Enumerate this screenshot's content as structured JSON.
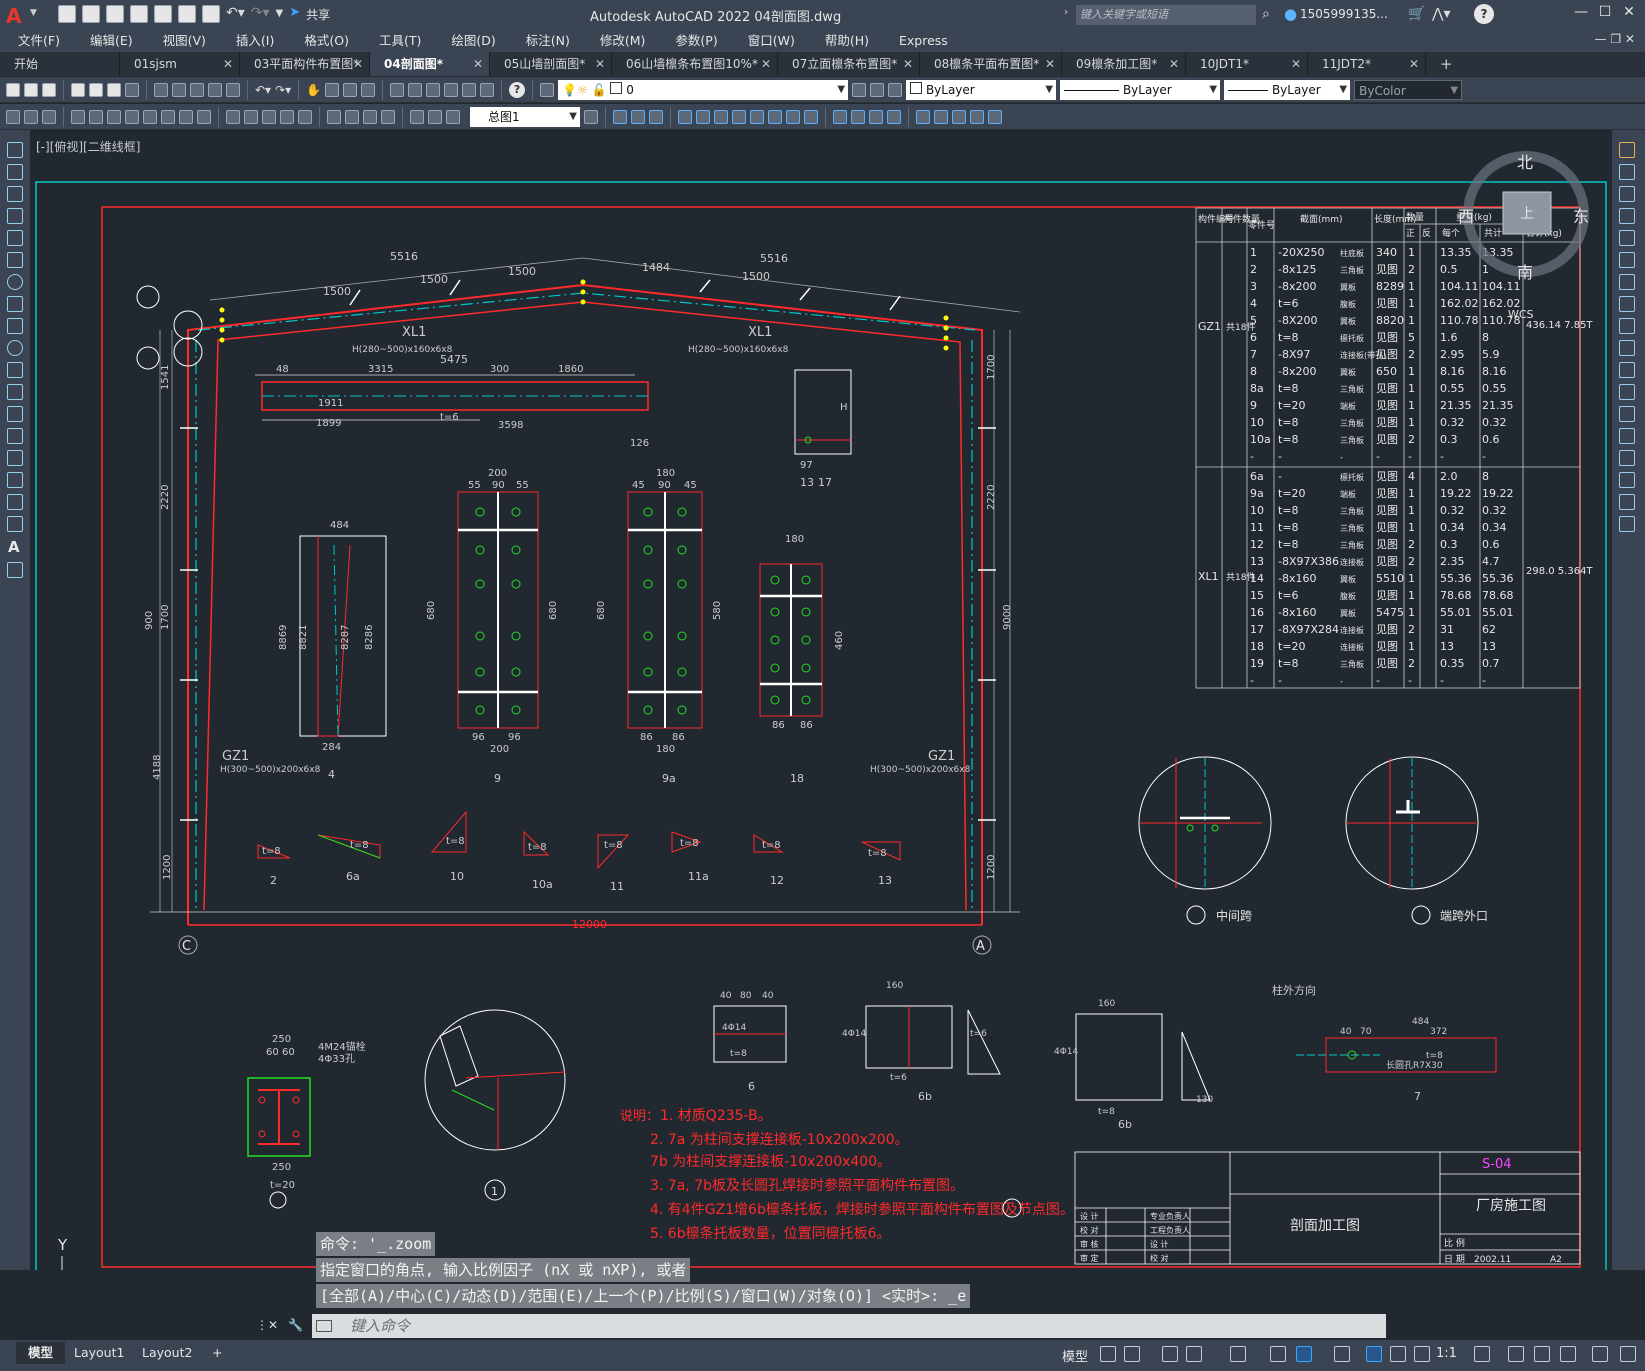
{
  "app": {
    "logo": "A",
    "title": "Autodesk AutoCAD 2022    04剖面图.dwg",
    "share": "共享",
    "search_placeholder": "键入关键字或短语",
    "user": "1505999135...",
    "help": "?"
  },
  "menu": [
    "文件(F)",
    "编辑(E)",
    "视图(V)",
    "插入(I)",
    "格式(O)",
    "工具(T)",
    "绘图(D)",
    "标注(N)",
    "修改(M)",
    "参数(P)",
    "窗口(W)",
    "帮助(H)",
    "Express"
  ],
  "tabs": [
    {
      "label": "开始",
      "active": false
    },
    {
      "label": "01sjsm",
      "active": false
    },
    {
      "label": "03平面构件布置图*",
      "active": false
    },
    {
      "label": "04剖面图*",
      "active": true
    },
    {
      "label": "05山墙剖面图*",
      "active": false
    },
    {
      "label": "06山墙檩条布置图10%*",
      "active": false
    },
    {
      "label": "07立面檩条布置图*",
      "active": false
    },
    {
      "label": "08檩条平面布置图*",
      "active": false
    },
    {
      "label": "09檩条加工图*",
      "active": false
    },
    {
      "label": "10JDT1*",
      "active": false
    },
    {
      "label": "11JDT2*",
      "active": false
    }
  ],
  "toolbar1": {
    "layer": "0",
    "color": "ByLayer",
    "linetype": "ByLayer",
    "lineweight": "ByLayer",
    "plotstyle": "ByColor"
  },
  "toolbar2": {
    "dimstyle": "总图1"
  },
  "viewport": {
    "label": "[-][俯视][二维线框]",
    "viewcube": {
      "north": "北",
      "south": "南",
      "east": "东",
      "west": "西",
      "top": "上",
      "wcs": "WCS"
    }
  },
  "drawing": {
    "frame_labels": [
      "GZ1",
      "XL1",
      "XL1",
      "GZ1"
    ],
    "beam_section": "H(280~500)x160x6x8",
    "column_section": "H(300~500)x200x6x8",
    "dims_top": [
      "1500",
      "1500",
      "1500",
      "1484",
      "1484",
      "1500",
      "1500",
      "1500",
      "5516",
      "5516",
      "5475"
    ],
    "span": "12000",
    "axis_c": "C",
    "axis_a": "A",
    "dims_left": [
      "1541",
      "2220",
      "900",
      "1700",
      "4188",
      "1200"
    ],
    "dims_right": [
      "1700",
      "2220",
      "9000",
      "1200"
    ],
    "detail_bar": [
      "48",
      "3315",
      "300",
      "1860",
      "1911",
      "1899",
      "3598",
      "t=6",
      "15",
      "132",
      "126"
    ],
    "plate_dims": [
      "200",
      "55",
      "90",
      "55",
      "180",
      "45",
      "90",
      "45",
      "484",
      "96",
      "86",
      "8",
      "680",
      "580",
      "460",
      "8869",
      "8821",
      "8287",
      "8286",
      "284",
      "97",
      "H"
    ],
    "small_parts": [
      "t=8",
      "t=8",
      "t=8",
      "t=8",
      "t=8",
      "t=8",
      "t=8",
      "t=8",
      "t=8"
    ],
    "callouts": [
      "2",
      "6a",
      "10",
      "10a",
      "11",
      "11a",
      "12",
      "13",
      "4",
      "9",
      "9a",
      "18",
      "13",
      "17",
      "1",
      "6",
      "6b",
      "6b",
      "7"
    ],
    "notes_title": "说明：",
    "notes": [
      "1. 材质Q235-B。",
      "2. 7a 为柱间支撑连接板-10x200x200。",
      "   7b 为柱间支撑连接板-10x200x400。",
      "3. 7a, 7b板及长圆孔焊接时参照平面构件布置图。",
      "4. 有4件GZ1增6b檩条托板，焊接时参照平面构件布置图及节点图。",
      "5. 6b檩条托板数量，位置同檩托板6。"
    ],
    "detail2_label": "中间跨",
    "detail3_label": "端跨外口",
    "base_plate": {
      "dims": [
        "250",
        "60",
        "60",
        "250",
        "4M24锚栓",
        "4Φ33孔",
        "t=20"
      ],
      "callout": "1"
    },
    "detail_plates": {
      "p6": [
        "40",
        "80",
        "40",
        "4Φ14",
        "50",
        "80",
        "50",
        "t=8"
      ],
      "p6b": [
        "160",
        "40",
        "80",
        "40",
        "4Φ14",
        "50",
        "80",
        "50",
        "150",
        "t=6",
        "80"
      ],
      "p6a": [
        "160",
        "40",
        "80",
        "40",
        "4Φ14",
        "50",
        "80",
        "257",
        "147",
        "t=8",
        "130",
        "t=6"
      ],
      "p7": [
        "柱外方向",
        "484",
        "40",
        "70",
        "372",
        "48",
        "49",
        "97",
        "长圆孔R7X30",
        "t=8"
      ]
    }
  },
  "table": {
    "headers": [
      "构件编号",
      "构件数量",
      "零件号",
      "截面(mm)",
      "长度(mm)",
      "数量",
      "正",
      "反",
      "重量(kg)",
      "每个",
      "共计",
      "合计(kg)"
    ],
    "groups": [
      {
        "member": "GZ1",
        "qty": "共18件",
        "total": "436.14 7.85T",
        "rows": [
          [
            "1",
            "-20X250",
            "柱底板",
            "340",
            "1",
            "13.35",
            "13.35"
          ],
          [
            "2",
            "-8x125",
            "三角板",
            "见图",
            "2",
            "0.5",
            "1"
          ],
          [
            "3",
            "-8x200",
            "翼板",
            "8289",
            "1",
            "104.11",
            "104.11"
          ],
          [
            "4",
            "t=6",
            "腹板",
            "见图",
            "1",
            "162.02",
            "162.02"
          ],
          [
            "5",
            "-8X200",
            "翼板",
            "8820",
            "1",
            "110.78",
            "110.78"
          ],
          [
            "6",
            "t=8",
            "檩托板",
            "见图",
            "5",
            "1.6",
            "8"
          ],
          [
            "7",
            "-8X97",
            "连接板(带孔)",
            "见图",
            "2",
            "2.95",
            "5.9"
          ],
          [
            "8",
            "-8x200",
            "翼板",
            "650",
            "1",
            "8.16",
            "8.16"
          ],
          [
            "8a",
            "t=8",
            "三角板",
            "见图",
            "1",
            "0.55",
            "0.55"
          ],
          [
            "9",
            "t=20",
            "端板",
            "见图",
            "1",
            "21.35",
            "21.35"
          ],
          [
            "10",
            "t=8",
            "三角板",
            "见图",
            "1",
            "0.32",
            "0.32"
          ],
          [
            "10a",
            "t=8",
            "三角板",
            "见图",
            "2",
            "0.3",
            "0.6"
          ],
          [
            "-",
            "-",
            "-",
            "-",
            "-",
            "-",
            "-"
          ]
        ]
      },
      {
        "member": "XL1",
        "qty": "共18件",
        "total": "298.0 5.364T",
        "rows": [
          [
            "6a",
            "-",
            "檩托板",
            "见图",
            "4",
            "2.0",
            "8"
          ],
          [
            "9a",
            "t=20",
            "端板",
            "见图",
            "1",
            "19.22",
            "19.22"
          ],
          [
            "10",
            "t=8",
            "三角板",
            "见图",
            "1",
            "0.32",
            "0.32"
          ],
          [
            "11",
            "t=8",
            "三角板",
            "见图",
            "1",
            "0.34",
            "0.34"
          ],
          [
            "12",
            "t=8",
            "三角板",
            "见图",
            "2",
            "0.3",
            "0.6"
          ],
          [
            "13",
            "-8X97X386",
            "连接板",
            "见图",
            "2",
            "2.35",
            "4.7"
          ],
          [
            "14",
            "-8x160",
            "翼板",
            "5510",
            "1",
            "55.36",
            "55.36"
          ],
          [
            "15",
            "t=6",
            "腹板",
            "见图",
            "1",
            "78.68",
            "78.68"
          ],
          [
            "16",
            "-8x160",
            "翼板",
            "5475",
            "1",
            "55.01",
            "55.01"
          ],
          [
            "17",
            "-8X97X284",
            "连接板",
            "见图",
            "2",
            "31",
            "62"
          ],
          [
            "18",
            "t=20",
            "连接板",
            "见图",
            "1",
            "13",
            "13"
          ],
          [
            "19",
            "t=8",
            "三角板",
            "见图",
            "2",
            "0.35",
            "0.7"
          ],
          [
            "-",
            "-",
            "-",
            "-",
            "-",
            "-",
            "-"
          ]
        ]
      }
    ]
  },
  "titleblock": {
    "drawing_no": "S-04",
    "project": "厂房施工图",
    "drawing_name": "剖面加工图",
    "row_labels": [
      "比 例",
      "日 期"
    ],
    "date": "2002.11",
    "sheet": "A2",
    "roles": [
      "设 计",
      "校 对",
      "审 核",
      "审 定",
      "制 图"
    ],
    "role_col": [
      "专业负责人",
      "工程负责人",
      "设 计",
      "校 对",
      "审 核"
    ]
  },
  "command": {
    "history": [
      "命令: '_.zoom",
      "指定窗口的角点, 输入比例因子 (nX 或 nXP), 或者",
      "[全部(A)/中心(C)/动态(D)/范围(E)/上一个(P)/比例(S)/窗口(W)/对象(O)] <实时>: _e"
    ],
    "placeholder": "键入命令"
  },
  "ucs": {
    "x": "X",
    "y": "Y"
  },
  "status": {
    "layouts": [
      "模型",
      "Layout1",
      "Layout2",
      "+"
    ],
    "model": "模型",
    "scale": "1:1"
  },
  "colors": {
    "bg": "#212830",
    "chrome": "#3b4453",
    "red": "#ff2a2a",
    "cyan": "#00c8c8",
    "green": "#22dd22",
    "yellow": "#ffff00",
    "magenta": "#ff44ff"
  }
}
